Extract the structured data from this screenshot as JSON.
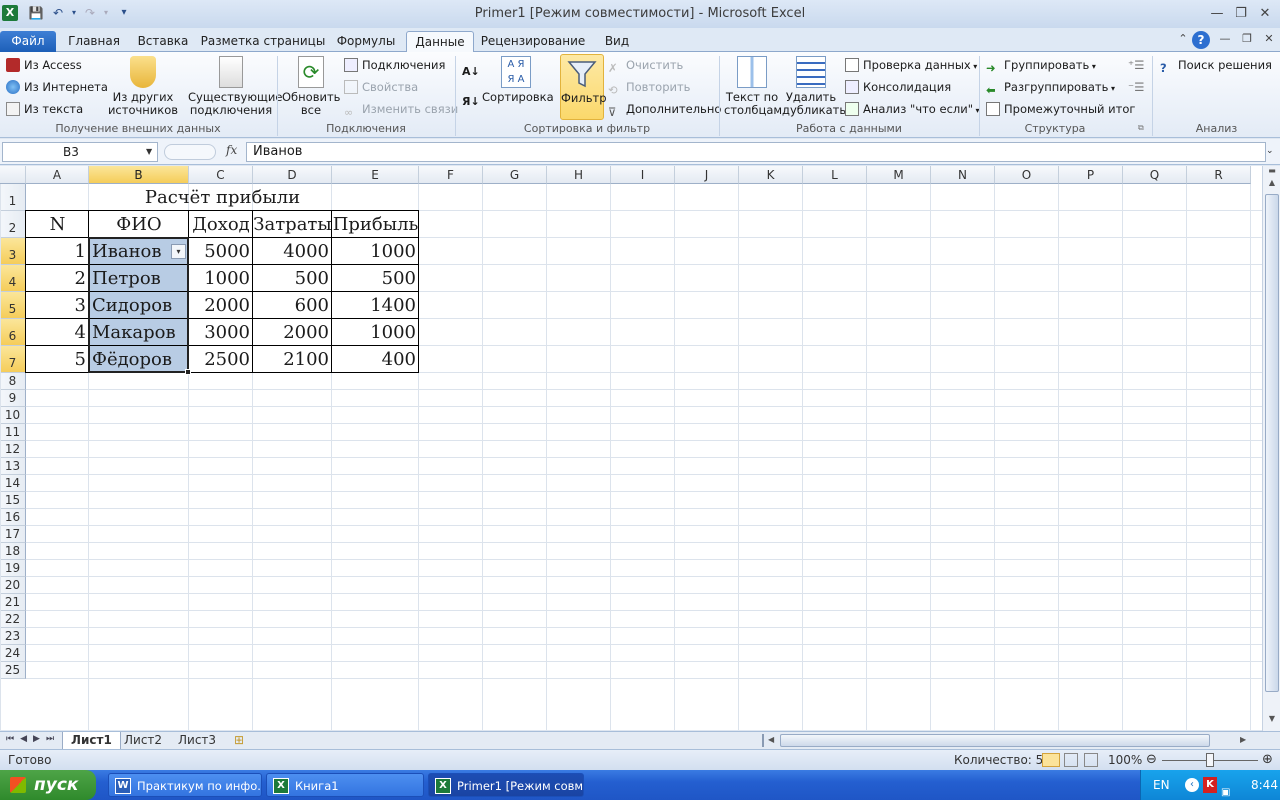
{
  "window": {
    "title": "Primer1  [Режим совместимости] - Microsoft Excel"
  },
  "tabs": {
    "file": "Файл",
    "items": [
      "Главная",
      "Вставка",
      "Разметка страницы",
      "Формулы",
      "Данные",
      "Рецензирование",
      "Вид"
    ],
    "active": "Данные"
  },
  "ribbon": {
    "external": {
      "access": "Из Access",
      "web": "Из Интернета",
      "text": "Из текста",
      "other": "Из других источников",
      "existing": "Существующие подключения",
      "label": "Получение внешних данных"
    },
    "connections": {
      "refresh": "Обновить все",
      "connections": "Подключения",
      "properties": "Свойства",
      "edit_links": "Изменить связи",
      "label": "Подключения"
    },
    "sort": {
      "sort": "Сортировка",
      "filter": "Фильтр",
      "clear": "Очистить",
      "reapply": "Повторить",
      "advanced": "Дополнительно",
      "label": "Сортировка и фильтр"
    },
    "datatools": {
      "text_to_columns": "Текст по столбцам",
      "remove_duplicates": "Удалить дубликаты",
      "validation": "Проверка данных",
      "consolidate": "Консолидация",
      "whatif": "Анализ \"что если\"",
      "label": "Работа с данными"
    },
    "outline": {
      "group": "Группировать",
      "ungroup": "Разгруппировать",
      "subtotal": "Промежуточный итог",
      "label": "Структура"
    },
    "analysis": {
      "solver": "Поиск решения",
      "label": "Анализ"
    }
  },
  "formula_bar": {
    "name_box": "B3",
    "fx": "fx",
    "value": "Иванов"
  },
  "sheet": {
    "columns": [
      "A",
      "B",
      "C",
      "D",
      "E",
      "F",
      "G",
      "H",
      "I",
      "J",
      "K",
      "L",
      "M",
      "N",
      "O",
      "P",
      "Q",
      "R"
    ],
    "rows": [
      "1",
      "2",
      "3",
      "4",
      "5",
      "6",
      "7",
      "8",
      "9",
      "10",
      "11",
      "12",
      "13",
      "14",
      "15",
      "16",
      "17",
      "18",
      "19",
      "20",
      "21",
      "22",
      "23",
      "24",
      "25"
    ],
    "title": "Расчёт прибыли",
    "headers": [
      "N",
      "ФИО",
      "Доход",
      "Затраты",
      "Прибыль"
    ],
    "data": [
      [
        "1",
        "Иванов",
        "5000",
        "4000",
        "1000"
      ],
      [
        "2",
        "Петров",
        "1000",
        "500",
        "500"
      ],
      [
        "3",
        "Сидоров",
        "2000",
        "600",
        "1400"
      ],
      [
        "4",
        "Макаров",
        "3000",
        "2000",
        "1000"
      ],
      [
        "5",
        "Фёдоров",
        "2500",
        "2100",
        "400"
      ]
    ]
  },
  "sheet_tabs": [
    "Лист1",
    "Лист2",
    "Лист3"
  ],
  "status": {
    "ready": "Готово",
    "count": "Количество: 5",
    "zoom": "100%"
  },
  "taskbar": {
    "start": "пуск",
    "tasks": [
      "Практикум по инфо...",
      "Книга1",
      "Primer1  [Режим совм..."
    ],
    "lang": "EN",
    "clock": "8:44"
  },
  "colors": {
    "selection": "#b8cce4",
    "header_selected": "#f5cd5a",
    "filter_active": "#fbd86b"
  }
}
